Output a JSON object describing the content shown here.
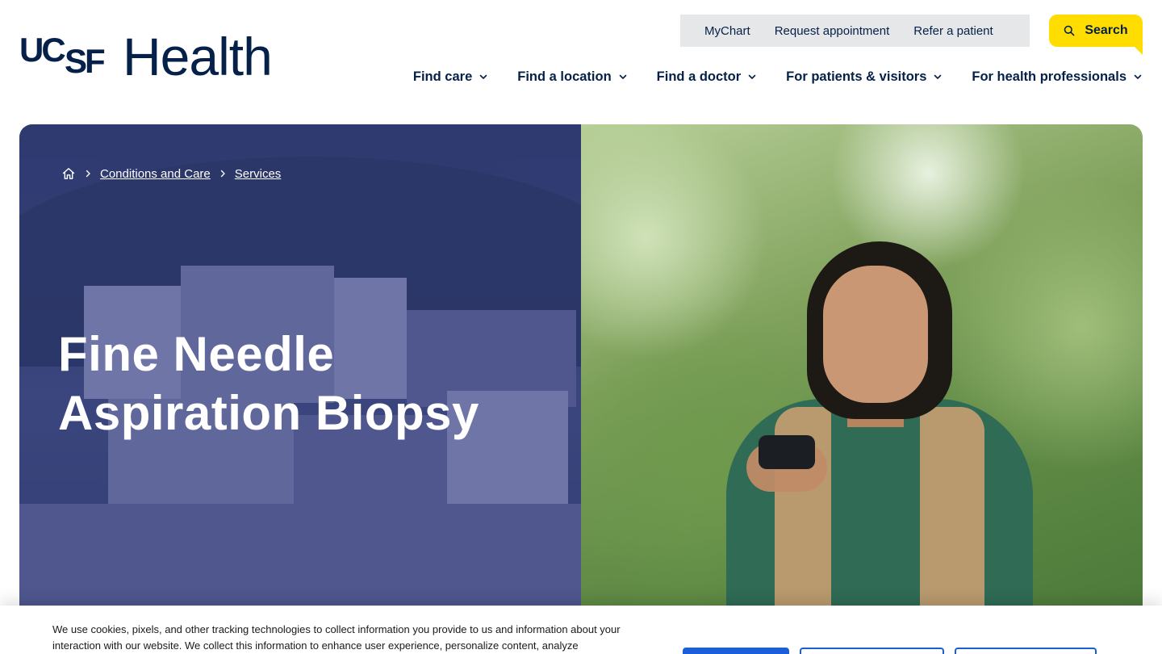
{
  "brand": {
    "logo_mark": "UCSF",
    "logo_uc": "UC",
    "logo_sf": "SF",
    "logo_word": "Health"
  },
  "utility_nav": {
    "items": [
      {
        "label": "MyChart"
      },
      {
        "label": "Request appointment"
      },
      {
        "label": "Refer a patient"
      }
    ]
  },
  "search": {
    "label": "Search",
    "icon": "search-icon"
  },
  "main_nav": {
    "items": [
      {
        "label": "Find care",
        "icon": "chevron-down-icon"
      },
      {
        "label": "Find a location",
        "icon": "chevron-down-icon"
      },
      {
        "label": "Find a doctor",
        "icon": "chevron-down-icon"
      },
      {
        "label": "For patients & visitors",
        "icon": "chevron-down-icon"
      },
      {
        "label": "For health professionals",
        "icon": "chevron-down-icon"
      }
    ]
  },
  "breadcrumb": {
    "home_icon": "home-icon",
    "items": [
      {
        "label": "Conditions and Care"
      },
      {
        "label": "Services"
      }
    ]
  },
  "hero": {
    "title_line1": "Fine Needle",
    "title_line2": "Aspiration Biopsy"
  },
  "cookie_banner": {
    "text": "We use cookies, pixels, and other tracking technologies to collect information you provide to us and information about your interaction with our website. We collect this information to enhance user experience, personalize content, analyze"
  },
  "colors": {
    "navy": "#052049",
    "accent_yellow": "#ffdd00",
    "utility_bg": "#e6e7e9",
    "cookie_button_blue": "#1a5fd6"
  }
}
